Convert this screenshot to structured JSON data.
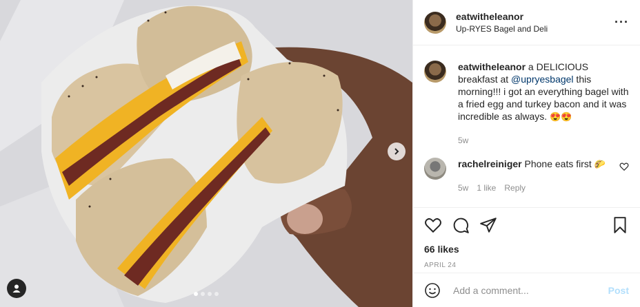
{
  "post": {
    "username": "eatwitheleanor",
    "location": "Up-RYES Bagel and Deli",
    "more_icon": "more-horizontal-icon"
  },
  "caption": {
    "username": "eatwitheleanor",
    "text_before": " a DELICIOUS breakfast at ",
    "mention": "@upryesbagel",
    "text_after": " this morning!!! i got an everything bagel with a fried egg and turkey bacon and it was incredible as always. ",
    "emojis": "😍😍",
    "time": "5w"
  },
  "comments": [
    {
      "username": "rachelreiniger",
      "text": " Phone eats first ",
      "emoji": "🌮",
      "time": "5w",
      "likes": "1 like",
      "reply": "Reply"
    }
  ],
  "actions": {
    "likes": "66 likes",
    "date": "APRIL 24"
  },
  "add_comment": {
    "placeholder": "Add a comment...",
    "post_label": "Post"
  },
  "carousel": {
    "count": 4,
    "active_index": 0
  }
}
